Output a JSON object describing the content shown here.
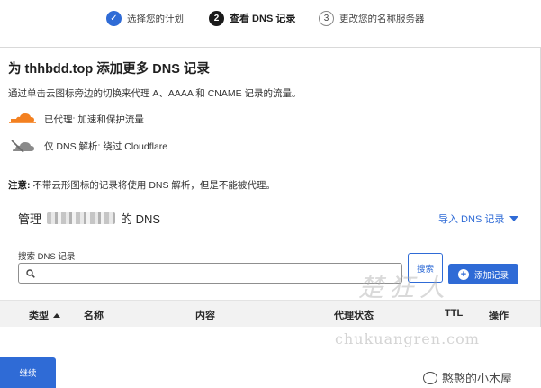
{
  "stepper": {
    "steps": [
      {
        "number": "✓",
        "label": "选择您的计划",
        "state": "done"
      },
      {
        "number": "2",
        "label": "查看 DNS 记录",
        "state": "current"
      },
      {
        "number": "3",
        "label": "更改您的名称服务器",
        "state": "next"
      }
    ]
  },
  "card": {
    "title": "为 thhbdd.top 添加更多 DNS 记录",
    "description": "通过单击云图标旁边的切换来代理 A、AAAA 和 CNAME 记录的流量。",
    "legend": [
      {
        "icon": "orange-cloud-icon",
        "color": "#f38020",
        "label": "已代理: 加速和保护流量"
      },
      {
        "icon": "gray-cloud-icon",
        "color": "#8a8a8a",
        "label": "仅 DNS 解析: 绕过 Cloudflare"
      }
    ],
    "note_prefix": "注意:",
    "note_text": " 不带云形图标的记录将使用 DNS 解析，但是不能被代理。"
  },
  "manage": {
    "prefix": "管理",
    "suffix": "的 DNS",
    "import_label": "导入 DNS 记录"
  },
  "search": {
    "label": "搜索 DNS 记录",
    "placeholder": "",
    "value": "",
    "search_button": "搜索",
    "add_button": "添加记录"
  },
  "table": {
    "columns": [
      "类型",
      "名称",
      "内容",
      "代理状态",
      "TTL",
      "操作"
    ]
  },
  "footer": {
    "continue_button": "继续"
  },
  "watermark": {
    "chinese": "楚狂人",
    "url": "chukuangren.com",
    "account": "憨憨的小木屋"
  },
  "colors": {
    "accent": "#2f6bd6",
    "proxied": "#f38020",
    "dns_only": "#8a8a8a"
  }
}
